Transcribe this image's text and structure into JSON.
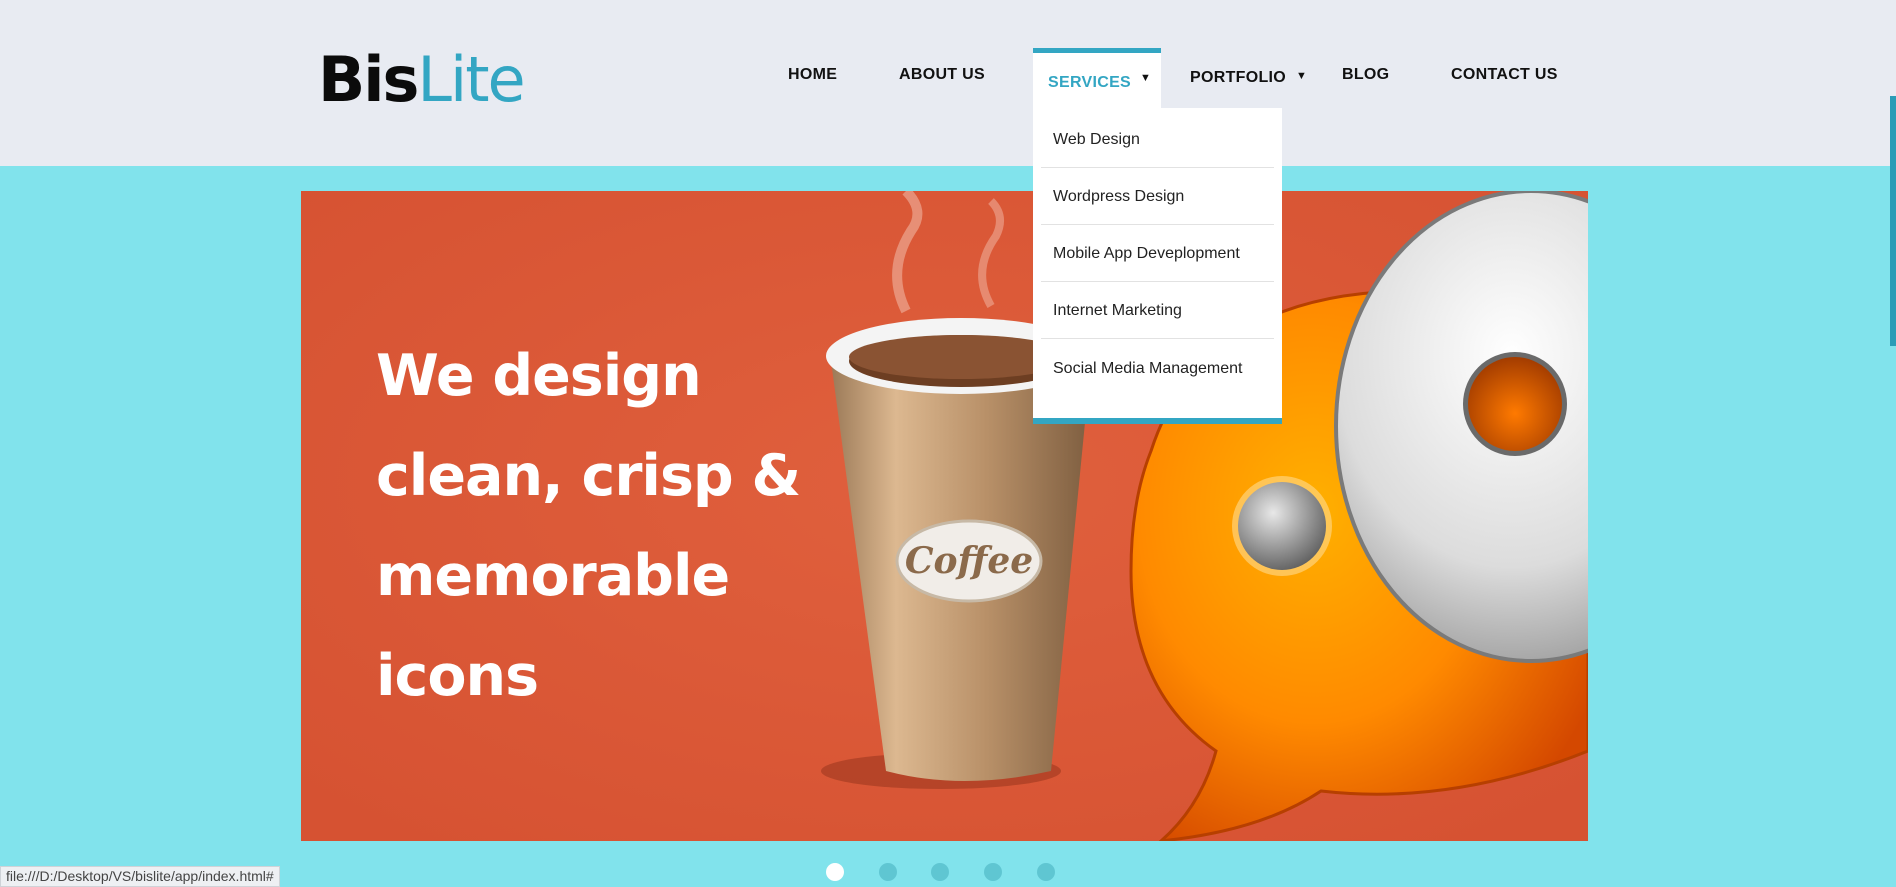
{
  "logo": {
    "part1": "Bis",
    "part2": "Lite"
  },
  "nav": {
    "home": "HOME",
    "about": "ABOUT US",
    "services": "SERVICES",
    "portfolio": "PORTFOLIO",
    "blog": "BLOG",
    "contact": "CONTACT US"
  },
  "dropdown": {
    "items": [
      "Web Design",
      "Wordpress Design",
      "Mobile App Deveplopment",
      "Internet Marketing",
      "Social Media Management"
    ]
  },
  "slide": {
    "line1": "We design",
    "line2": "clean, crisp &",
    "line3": "memorable",
    "line4": "icons",
    "cup_label": "Coffee"
  },
  "slider_dots": {
    "count": 5,
    "active_index": 0
  },
  "status_bar": "file:///D:/Desktop/VS/bislite/app/index.html#",
  "colors": {
    "accent": "#33a6c3",
    "background": "#81e3ec",
    "slide_bg": "#dc5836",
    "header_bg": "#e8ebf2"
  }
}
